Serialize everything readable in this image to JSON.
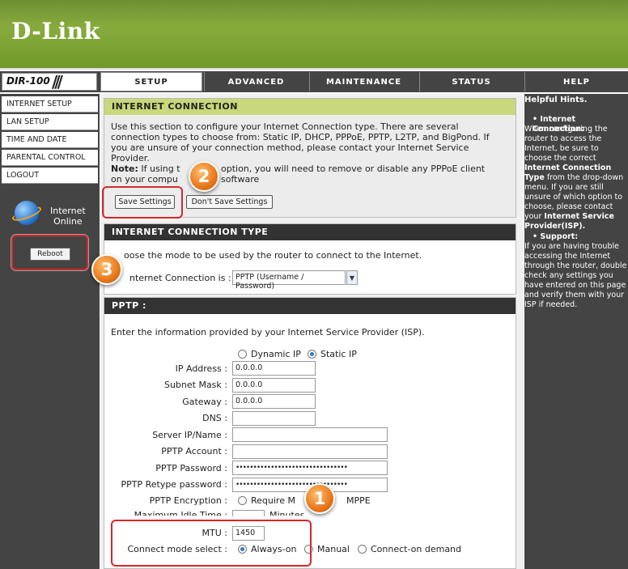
{
  "brand": "D-Link",
  "model": "DIR-100",
  "tabs": [
    "SETUP",
    "ADVANCED",
    "MAINTENANCE",
    "STATUS",
    "HELP"
  ],
  "sidebar": {
    "items": [
      "INTERNET SETUP",
      "LAN SETUP",
      "TIME AND DATE",
      "PARENTAL CONTROL",
      "LOGOUT"
    ],
    "internet_status": [
      "Internet",
      "Online"
    ],
    "reboot_label": "Reboot"
  },
  "internet_connection": {
    "title": "INTERNET CONNECTION",
    "description": "Use this section to configure your Internet Connection type. There are several connection types to choose from: Static IP, DHCP, PPPoE, PPTP, L2TP, and BigPond. If you are unsure of your connection method, please contact your Internet Service Provider.",
    "note_bold": "Note:",
    "note_a": "If using t",
    "note_b": "option, you will need to remove or disable any PPPoE client software",
    "note_c": "on your compu",
    "save_label": "Save Settings",
    "dont_save_label": "Don't Save Settings"
  },
  "connection_type": {
    "title": "INTERNET CONNECTION TYPE",
    "desc": "oose the mode to be used by the router to connect to the Internet.",
    "field_label": "nternet Connection is :",
    "selected": "PPTP (Username / Password)"
  },
  "pptp": {
    "title": "PPTP :",
    "intro": "Enter the information provided by your Internet Service Provider (ISP).",
    "dynamic_ip": "Dynamic IP",
    "static_ip": "Static IP",
    "ip_label": "IP Address :",
    "ip_value": "0.0.0.0",
    "subnet_label": "Subnet Mask :",
    "subnet_value": "0.0.0.0",
    "gateway_label": "Gateway :",
    "gateway_value": "0.0.0.0",
    "dns_label": "DNS :",
    "server_label": "Server IP/Name :",
    "account_label": "PPTP Account :",
    "password_label": "PPTP Password :",
    "password_value": "••••••••••••••••••••••••••••••••",
    "retype_label": "PPTP Retype password :",
    "retype_value": "••••••••••••••••••••••••••••••••",
    "encryption_label": "PPTP Encryption :",
    "encryption_option_a": "Require M",
    "encryption_option_b": "MPPE",
    "idle_label": "Maximum Idle Time :",
    "idle_suffix": "Minutes",
    "mtu_label": "MTU :",
    "mtu_value": "1450",
    "mode_label": "Connect mode select :",
    "mode_always": "Always-on",
    "mode_manual": "Manual",
    "mode_demand": "Connect-on demand"
  },
  "help": {
    "title": "Helpful Hints.",
    "ic_heading": "• Internet Connection:",
    "ic_text_1": "When configuring the router to access the Internet, be sure to choose the correct",
    "ic_bold_1": "Internet Connection Type",
    "ic_text_2": "from the drop-down menu. If you are still unsure of which option to choose, please contact your",
    "ic_bold_2": "Internet Service Provider(ISP).",
    "support_heading": "• Support:",
    "support_text": "If you are having trouble accessing the Internet through the router, double check any settings you have entered on this page and verify them with your ISP if needed."
  },
  "callouts": [
    "1",
    "2",
    "3"
  ],
  "colors": {
    "header_green": "#7fa136",
    "nav_dark": "#444444",
    "callout_red": "#d8262b",
    "badge_orange": "#e8771a"
  }
}
